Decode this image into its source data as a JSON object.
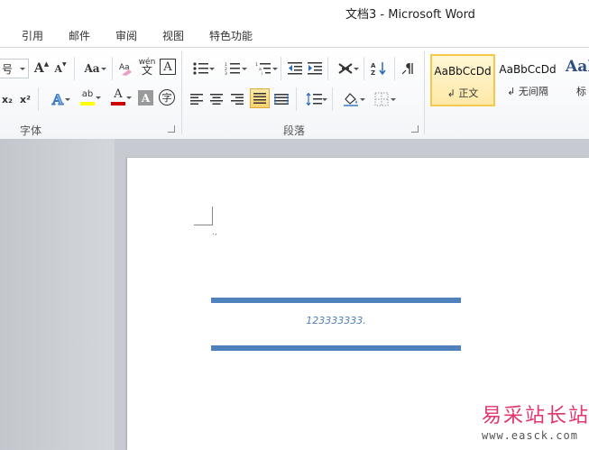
{
  "window": {
    "title": "文档3  -  Microsoft Word"
  },
  "tabs": [
    "引用",
    "邮件",
    "审阅",
    "视图",
    "特色功能"
  ],
  "ribbon": {
    "font_group": {
      "label": "字体",
      "font_size_partial": "号",
      "grow_font_label": "A",
      "shrink_font_label": "A",
      "change_case_label": "Aa",
      "phonetic_label": "wén",
      "char_border_label": "A",
      "text_effect_label": "A",
      "highlight_label": "ab",
      "font_color_label": "A",
      "char_shading_label": "A",
      "enclose_label": "字"
    },
    "paragraph_group": {
      "label": "段落"
    },
    "styles": [
      {
        "sample": "AaBbCcDd",
        "name": "↲ 正文",
        "selected": true
      },
      {
        "sample": "AaBbCcDd",
        "name": "↲ 无间隔",
        "selected": false
      },
      {
        "sample": "AaI",
        "name": "标",
        "selected": false
      }
    ]
  },
  "document": {
    "paragraph_mark": ".,",
    "text": "123333333.",
    "line_color": "#4f81bd"
  },
  "watermark": {
    "cn": "易采站长站",
    "url": "www.easck.com"
  },
  "colors": {
    "accent": "#4f81bd",
    "highlight": "#ffff00",
    "font_red": "#d00000",
    "watermark": "#e1366b"
  }
}
